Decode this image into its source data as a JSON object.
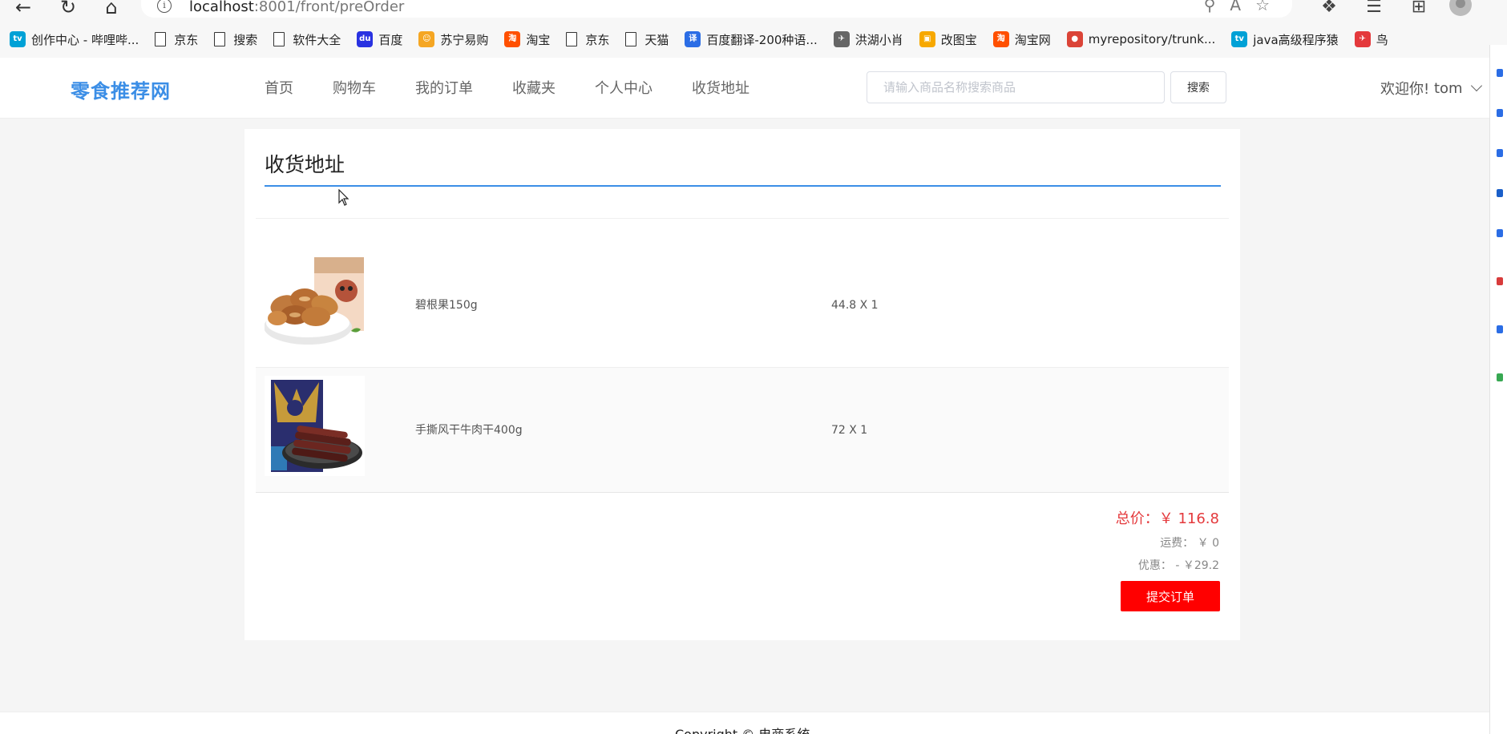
{
  "browser": {
    "url_host": "localhost",
    "url_rest": ":8001/front/preOrder",
    "bookmarks": [
      {
        "label": "创作中心 - 哔哩哔...",
        "icon": "bilibili-icon",
        "color": "#00a1d6"
      },
      {
        "label": "京东",
        "icon": "page-icon",
        "color": ""
      },
      {
        "label": "搜索",
        "icon": "page-icon",
        "color": ""
      },
      {
        "label": "软件大全",
        "icon": "page-icon",
        "color": ""
      },
      {
        "label": "百度",
        "icon": "baidu-icon",
        "color": "#2932e1"
      },
      {
        "label": "苏宁易购",
        "icon": "suning-icon",
        "color": "#f5a623"
      },
      {
        "label": "淘宝",
        "icon": "taobao-icon",
        "color": "#ff5000"
      },
      {
        "label": "京东",
        "icon": "page-icon",
        "color": ""
      },
      {
        "label": "天猫",
        "icon": "page-icon",
        "color": ""
      },
      {
        "label": "百度翻译-200种语...",
        "icon": "translate-icon",
        "color": "#2b6de5"
      },
      {
        "label": "洪湖小肖",
        "icon": "bird-icon",
        "color": "#666666"
      },
      {
        "label": "改图宝",
        "icon": "gaitubao-icon",
        "color": "#f7a800"
      },
      {
        "label": "淘宝网",
        "icon": "taobao-icon",
        "color": "#ff5000"
      },
      {
        "label": "myrepository/trunk...",
        "icon": "chrome-icon",
        "color": "#db4437"
      },
      {
        "label": "java高级程序猿",
        "icon": "bilibili-icon",
        "color": "#00a1d6"
      },
      {
        "label": "鸟",
        "icon": "bird-icon",
        "color": "#e4393c"
      }
    ]
  },
  "header": {
    "logo": "零食推荐网",
    "nav": [
      "首页",
      "购物车",
      "我的订单",
      "收藏夹",
      "个人中心",
      "收货地址"
    ],
    "search_placeholder": "请输入商品名称搜索商品",
    "search_button": "搜索",
    "welcome": "欢迎你!",
    "username": "tom"
  },
  "order": {
    "title": "收货地址",
    "items": [
      {
        "name": "碧根果150g",
        "price": "44.8 X 1"
      },
      {
        "name": "手撕风干牛肉干400g",
        "price": "72 X 1"
      }
    ],
    "total": "总价：￥ 116.8",
    "shipping": "运费：  ￥ 0",
    "discount": "优惠：  - ￥29.2",
    "submit": "提交订单"
  },
  "footer": {
    "copyright": "Copyright © 电商系统"
  },
  "colors": {
    "accent": "#3b8ee6",
    "price_red": "#e4393c",
    "submit_red": "#ff0000"
  }
}
